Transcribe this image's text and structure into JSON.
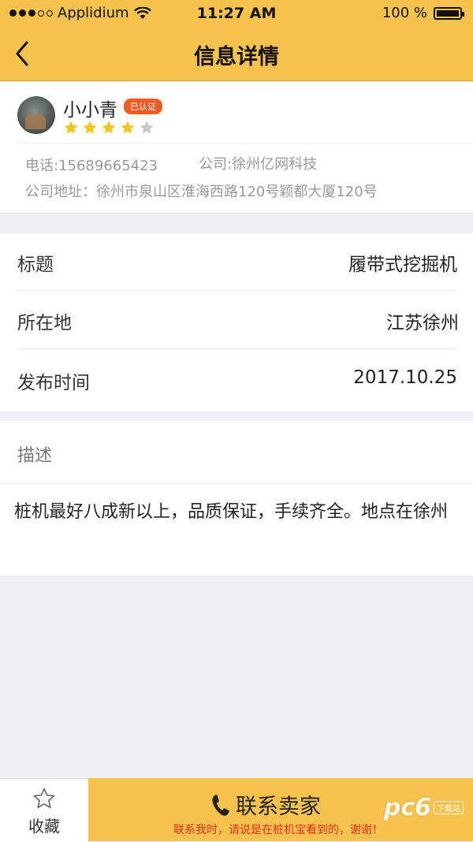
{
  "status_bar": {
    "carrier": "Applidium",
    "time": "11:27 AM",
    "battery": "100 %"
  },
  "nav": {
    "title": "信息详情",
    "back_icon": "chevron-left-icon"
  },
  "seller": {
    "name": "小小青",
    "badge": "已认证",
    "rating": 4,
    "rating_max": 5,
    "phone": "电话:15689665423",
    "company": "公司:徐州亿网科技",
    "address": "公司地址：徐州市泉山区淮海西路120号颖都大厦120号"
  },
  "details": [
    {
      "label": "标题",
      "value": "履带式挖掘机"
    },
    {
      "label": "所在地",
      "value": "江苏徐州"
    },
    {
      "label": "发布时间",
      "value": "2017.10.25"
    }
  ],
  "description": {
    "label": "描述",
    "text": "桩机最好八成新以上，品质保证，手续齐全。地点在徐州"
  },
  "bottom": {
    "favorite_label": "收藏",
    "contact_label": "联系卖家",
    "contact_sub": "联系我时，请说是在桩机宝看到的，谢谢！"
  },
  "watermark": {
    "logo": "pc6",
    "sub": "下载站"
  },
  "colors": {
    "brand_yellow": "#f7c24e",
    "badge_orange": "#f25b22",
    "star_gold": "#f5c518",
    "notice_red": "#e0301e"
  }
}
